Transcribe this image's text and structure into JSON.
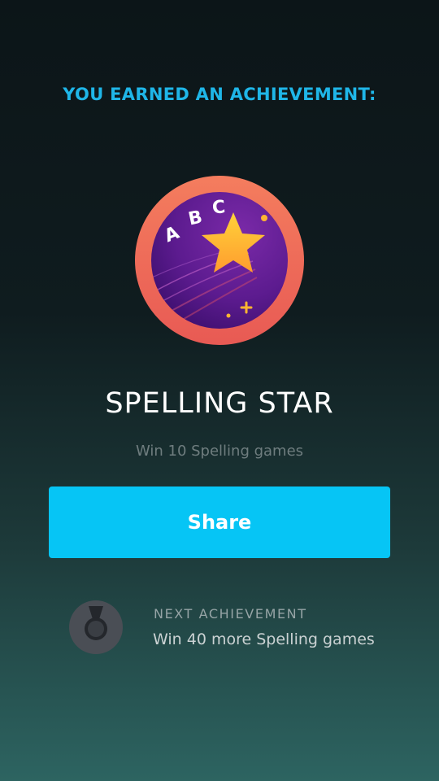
{
  "header": {
    "text": "YOU EARNED AN ACHIEVEMENT:"
  },
  "achievement": {
    "badge_icon": "star-badge-icon",
    "badge_letters": [
      "A",
      "B",
      "C"
    ],
    "title": "SPELLING STAR",
    "description": "Win 10 Spelling games"
  },
  "share_button": {
    "label": "Share"
  },
  "next_achievement": {
    "icon": "medal-icon",
    "label": "NEXT ACHIEVEMENT",
    "description": "Win 40 more Spelling games"
  },
  "colors": {
    "accent": "#1fb6e8",
    "button": "#06c5f5",
    "badge_ring": "#ef6b5c",
    "badge_inner": "#5a1a8c",
    "star": "#ffb531"
  }
}
